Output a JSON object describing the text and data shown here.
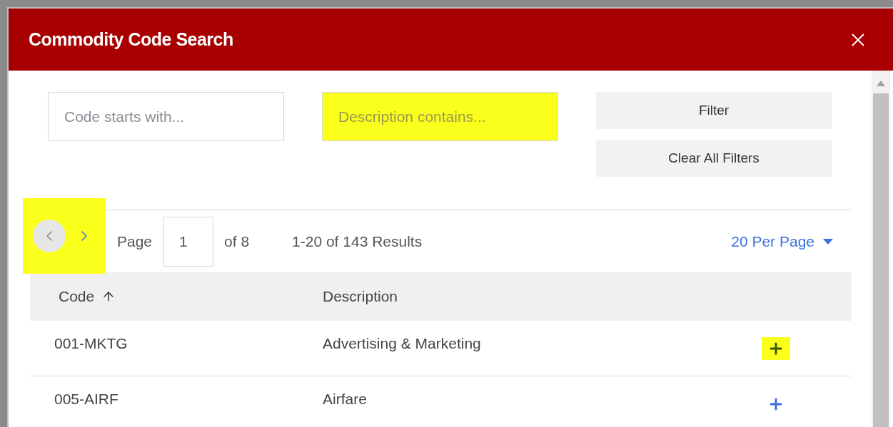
{
  "dialog": {
    "title": "Commodity Code Search"
  },
  "filters": {
    "fields": [
      {
        "placeholder": "Code starts with...",
        "highlighted": false
      },
      {
        "placeholder": "Description contains...",
        "highlighted": true
      }
    ],
    "buttons": [
      "Filter",
      "Clear All Filters"
    ]
  },
  "pager": {
    "highlighted": true,
    "previous_disabled": true,
    "page_label": "Page",
    "page": "1",
    "of": "of 8",
    "results": "1-20 of 143 Results",
    "per_page": "20 Per Page"
  },
  "table": {
    "columns": [
      {
        "label": "Code",
        "sorted_ascending": true
      },
      {
        "label": "Description",
        "sorted_ascending": false
      }
    ],
    "rows": [
      {
        "code": "001-MKTG",
        "description": "Advertising & Marketing",
        "add_highlighted": true
      },
      {
        "code": "005-AIRF",
        "description": "Airfare",
        "add_highlighted": false
      }
    ]
  }
}
